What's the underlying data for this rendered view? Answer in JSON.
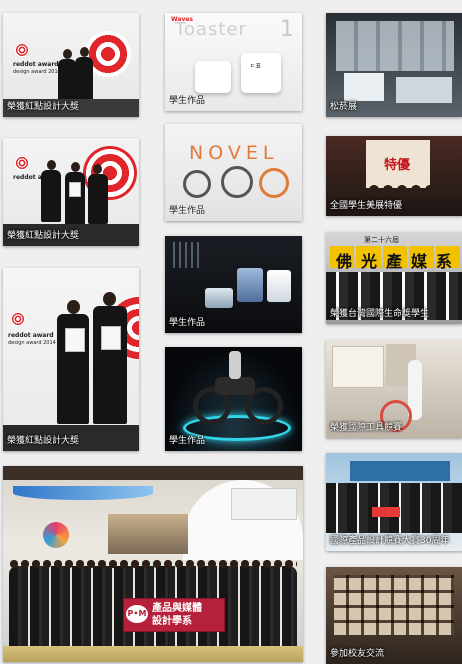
{
  "tiles": {
    "t1": {
      "caption": "榮獲紅點設計大獎",
      "logo": "reddot award",
      "logo_sub": "design award 2014"
    },
    "t2": {
      "caption": "學生作品",
      "brand": "Waves",
      "word": "Toaster",
      "number": "1",
      "tag": "ㄷ표"
    },
    "t3": {
      "caption": "松菸展"
    },
    "t4": {
      "caption": "榮獲紅點設計大獎",
      "logo": "reddot award"
    },
    "t5": {
      "caption": "學生作品",
      "word": "NOVEL"
    },
    "t6": {
      "caption": "全國學生美展特優",
      "board": "特優"
    },
    "t7": {
      "caption": "榮獲紅點設計大獎",
      "logo": "reddot award",
      "logo_sub": "design award 2014"
    },
    "t8": {
      "caption": "學生作品"
    },
    "t9": {
      "caption": "榮獲台灣國際生命獎學生",
      "sign_top": "第二十六屆",
      "sign_main": "佛光產媒系"
    },
    "t10": {
      "caption": "學生作品"
    },
    "t11": {
      "caption": "榮獲國際工具競賽"
    },
    "t12": {
      "caption": "國際產品設計競賽大賞30周年"
    },
    "t13": {
      "banner": "產品與媒體\n設計學系",
      "badge": "P•M"
    },
    "t14": {
      "caption": "參加校友交流"
    }
  },
  "colors": {
    "reddot_red": "#e0262b",
    "bg": "#efefef",
    "sign_yellow": "#f2c200"
  }
}
